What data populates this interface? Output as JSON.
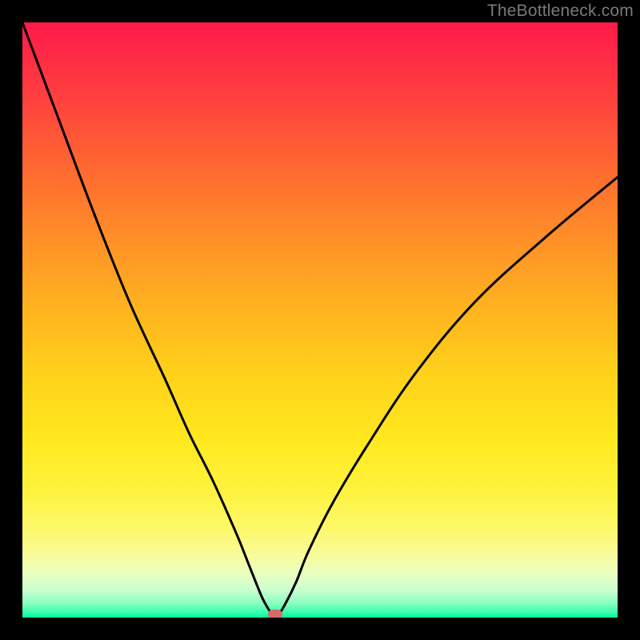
{
  "watermark": "TheBottleneck.com",
  "chart_data": {
    "type": "line",
    "title": "",
    "xlabel": "",
    "ylabel": "",
    "xlim": [
      0,
      100
    ],
    "ylim": [
      0,
      100
    ],
    "grid": false,
    "series": [
      {
        "name": "bottleneck-curve",
        "x": [
          0,
          6,
          12,
          18,
          24,
          28,
          32,
          36,
          38,
          40,
          41,
          42,
          43,
          44,
          46,
          48,
          52,
          58,
          66,
          76,
          88,
          100
        ],
        "values": [
          100,
          84,
          68,
          53,
          40,
          31,
          23,
          14,
          9,
          4,
          2,
          0.6,
          0.6,
          2,
          6,
          11,
          19,
          29,
          41,
          53,
          64,
          74
        ]
      }
    ],
    "marker": {
      "x": 42.5,
      "y": 0.5
    }
  },
  "colors": {
    "curve": "#000000",
    "marker": "#d76a6a",
    "background_top": "#ff1a4b",
    "background_bottom": "#07f59b",
    "frame": "#000000",
    "watermark": "#7a7a7a"
  }
}
